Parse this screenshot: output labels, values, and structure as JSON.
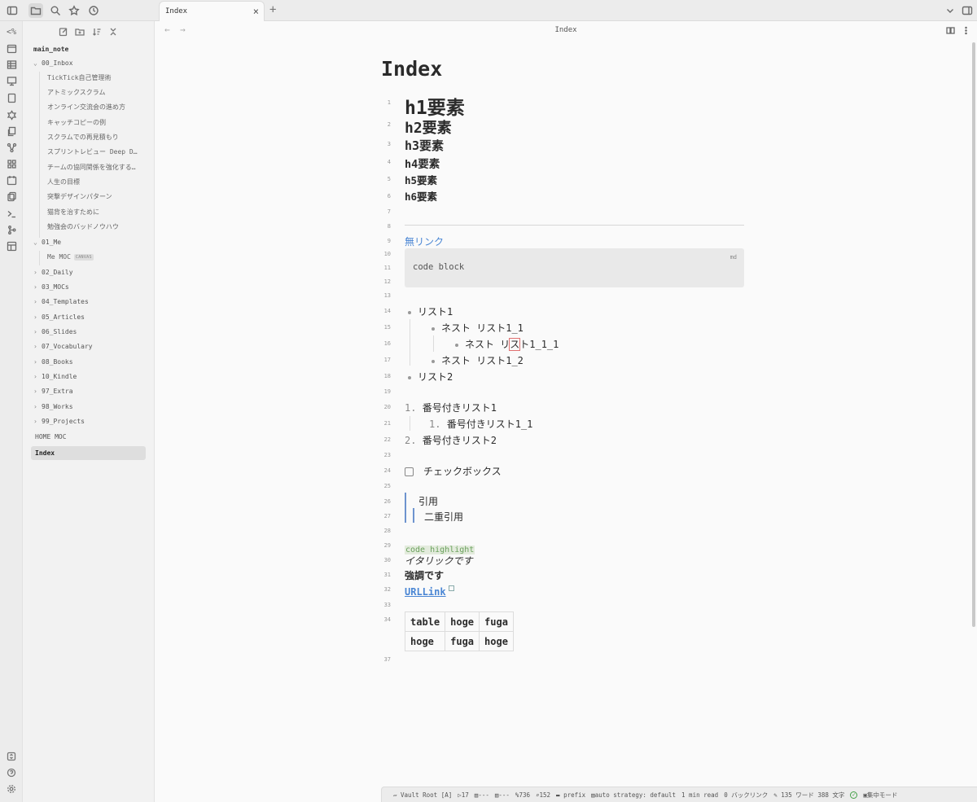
{
  "tab": {
    "title": "Index",
    "close": "×",
    "new": "+"
  },
  "view": {
    "title": "Index",
    "back": "←",
    "forward": "→"
  },
  "ribbon": {
    "top_label": "<%"
  },
  "vault": {
    "name": "main_note"
  },
  "tree": [
    {
      "label": "00_Inbox",
      "type": "folder",
      "open": true
    },
    {
      "label": "TickTick自己管理術",
      "type": "file"
    },
    {
      "label": "アトミックスクラム",
      "type": "file"
    },
    {
      "label": "オンライン交流会の進め方",
      "type": "file"
    },
    {
      "label": "キャッチコピーの例",
      "type": "file"
    },
    {
      "label": "スクラムでの再見積もり",
      "type": "file"
    },
    {
      "label": "スプリントレビュー Deep D…",
      "type": "file"
    },
    {
      "label": "チームの協同関係を強化する…",
      "type": "file"
    },
    {
      "label": "人生の目標",
      "type": "file"
    },
    {
      "label": "突撃デザインパターン",
      "type": "file"
    },
    {
      "label": "猫背を治すために",
      "type": "file"
    },
    {
      "label": "勉強会のバッドノウハウ",
      "type": "file"
    },
    {
      "label": "01_Me",
      "type": "folder",
      "open": true
    },
    {
      "label": "Me MOC",
      "type": "file",
      "badge": "CANVAS"
    },
    {
      "label": "02_Daily",
      "type": "folder"
    },
    {
      "label": "03_MOCs",
      "type": "folder"
    },
    {
      "label": "04_Templates",
      "type": "folder"
    },
    {
      "label": "05_Articles",
      "type": "folder"
    },
    {
      "label": "06_Slides",
      "type": "folder"
    },
    {
      "label": "07_Vocabulary",
      "type": "folder"
    },
    {
      "label": "08_Books",
      "type": "folder"
    },
    {
      "label": "10_Kindle",
      "type": "folder"
    },
    {
      "label": "97_Extra",
      "type": "folder"
    },
    {
      "label": "98_Works",
      "type": "folder"
    },
    {
      "label": "99_Projects",
      "type": "folder"
    },
    {
      "label": "HOME MOC",
      "type": "root"
    },
    {
      "label": "Index",
      "type": "root",
      "selected": true
    }
  ],
  "note": {
    "title": "Index",
    "lines": {
      "l1": "h1要素",
      "l2": "h2要素",
      "l3": "h3要素",
      "l4": "h4要素",
      "l5": "h5要素",
      "l6": "h6要素",
      "l9": "無リンク",
      "code_lang": "md",
      "code_text": "code block",
      "l14": "リスト1",
      "l15": "ネスト リスト1_1",
      "l16a": "ネスト リ",
      "l16b": "ス",
      "l16c": "ト1_1_1",
      "l17": "ネスト リスト1_2",
      "l18": "リスト2",
      "l20n": "1.",
      "l20": "番号付きリスト1",
      "l21n": "1.",
      "l21": "番号付きリスト1_1",
      "l22n": "2.",
      "l22": "番号付きリスト2",
      "l24": "チェックボックス",
      "l26": "引用",
      "l27": "二重引用",
      "l29": "code highlight",
      "l30": "イタリックです",
      "l31": "強調です",
      "l32": "URLLink"
    },
    "table": [
      [
        "table",
        "hoge",
        "fuga"
      ],
      [
        "hoge",
        "fuga",
        "hoge"
      ]
    ],
    "line_numbers": [
      "1",
      "2",
      "3",
      "4",
      "5",
      "6",
      "7",
      "8",
      "9",
      "10",
      "11",
      "12",
      "13",
      "14",
      "15",
      "16",
      "17",
      "18",
      "19",
      "20",
      "21",
      "22",
      "23",
      "24",
      "25",
      "26",
      "27",
      "28",
      "29",
      "30",
      "31",
      "32",
      "33",
      "34",
      "37"
    ]
  },
  "status": {
    "vault": "Vault Root [A]",
    "s1": "17",
    "s2": "---",
    "s3": "---",
    "s4": "736",
    "s5": "152",
    "prefix": "prefix",
    "strategy": "auto strategy: default",
    "read": "1 min read",
    "backlinks": "0 バックリンク",
    "words": "135 ワード 388 文字",
    "focus": "集中モード"
  }
}
